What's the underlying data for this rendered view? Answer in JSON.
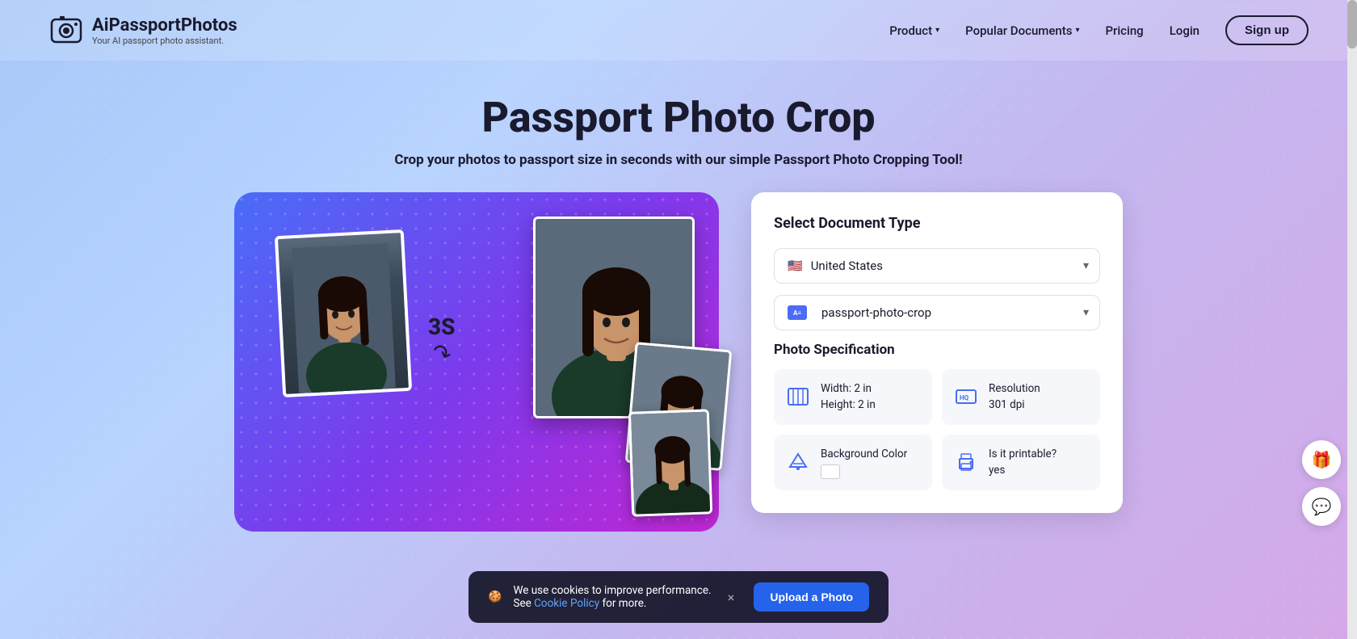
{
  "brand": {
    "name": "AiPassportPhotos",
    "tagline": "Your AI passport photo assistant.",
    "logo_icon": "camera"
  },
  "nav": {
    "items": [
      {
        "label": "Product",
        "has_dropdown": true
      },
      {
        "label": "Popular Documents",
        "has_dropdown": true
      },
      {
        "label": "Pricing",
        "has_dropdown": false
      },
      {
        "label": "Login",
        "has_dropdown": false
      }
    ],
    "signup_label": "Sign up"
  },
  "hero": {
    "title": "Passport Photo Crop",
    "subtitle": "Crop your photos to passport size in seconds with our simple Passport Photo Cropping Tool!"
  },
  "illustration": {
    "timer_label": "3S",
    "arrow": "↗"
  },
  "panel": {
    "document_type_title": "Select Document Type",
    "country_label": "United States",
    "document_label": "passport-photo-crop",
    "spec_title": "Photo Specification",
    "specs": [
      {
        "id": "size",
        "label": "Width: 2 in\nHeight: 2 in",
        "icon": "size-icon"
      },
      {
        "id": "resolution",
        "label": "Resolution\n301 dpi",
        "icon": "hd-icon"
      },
      {
        "id": "background",
        "label": "Background Color",
        "icon": "bg-icon",
        "has_swatch": true
      },
      {
        "id": "printable",
        "label": "Is it printable?\nyes",
        "icon": "print-icon"
      }
    ]
  },
  "upload_button": {
    "label": "Upload a Photo"
  },
  "cookie": {
    "message": "We use cookies to improve performance. See ",
    "link_text": "Cookie Policy",
    "link_suffix": " for more.",
    "close_label": "×"
  },
  "floating": {
    "gift_icon": "🎁",
    "chat_icon": "💬"
  }
}
